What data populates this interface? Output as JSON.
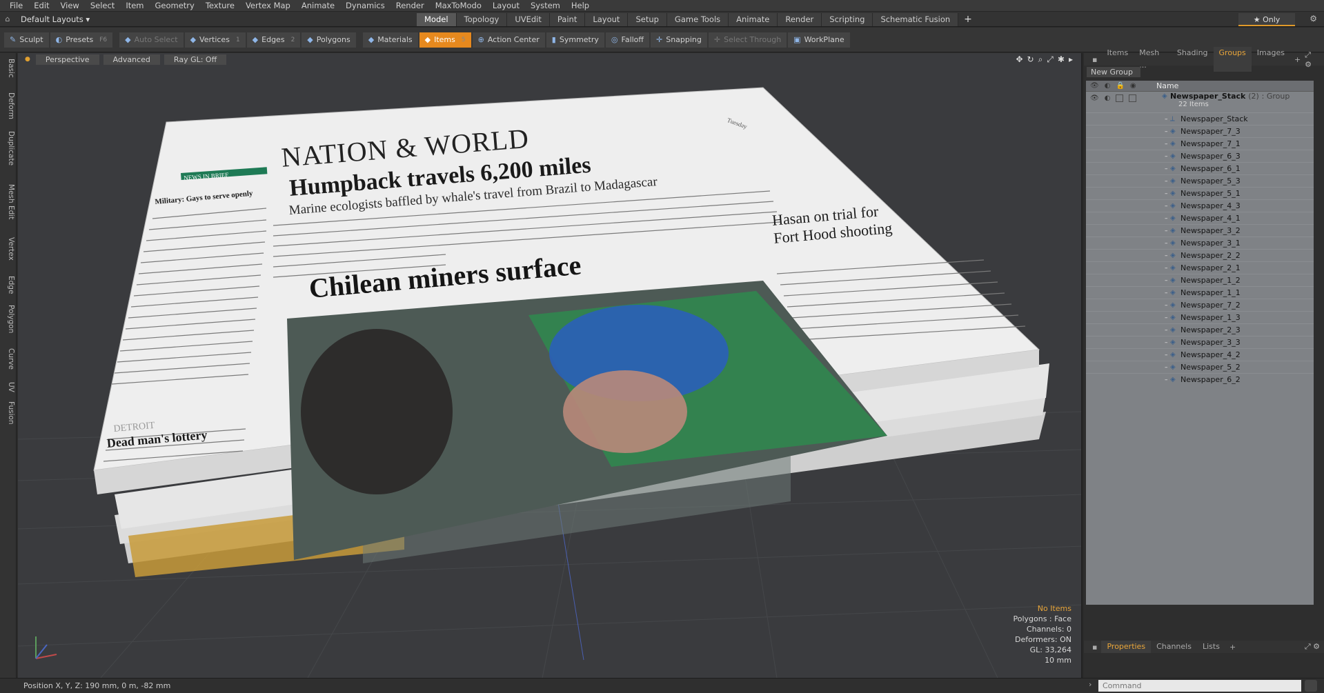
{
  "menu": [
    "File",
    "Edit",
    "View",
    "Select",
    "Item",
    "Geometry",
    "Texture",
    "Vertex Map",
    "Animate",
    "Dynamics",
    "Render",
    "MaxToModo",
    "Layout",
    "System",
    "Help"
  ],
  "layout_selector": "Default Layouts ▾",
  "tabs": [
    {
      "label": "Model",
      "active": true
    },
    {
      "label": "Topology"
    },
    {
      "label": "UVEdit"
    },
    {
      "label": "Paint"
    },
    {
      "label": "Layout"
    },
    {
      "label": "Setup"
    },
    {
      "label": "Game Tools"
    },
    {
      "label": "Animate"
    },
    {
      "label": "Render"
    },
    {
      "label": "Scripting"
    },
    {
      "label": "Schematic Fusion"
    }
  ],
  "only_label": "★ Only",
  "toolbar": {
    "sculpt": "Sculpt",
    "presets": "Presets",
    "presets_key": "F6",
    "auto_select": "Auto Select",
    "vertices": "Vertices",
    "vertices_key": "1",
    "edges": "Edges",
    "edges_key": "2",
    "polygons": "Polygons",
    "materials": "Materials",
    "items": "Items",
    "items_key": "5",
    "action_center": "Action Center",
    "symmetry": "Symmetry",
    "falloff": "Falloff",
    "snapping": "Snapping",
    "select_through": "Select Through",
    "workplane": "WorkPlane"
  },
  "left_tabs": [
    "Basic",
    "Deform",
    "Duplicate",
    "Mesh Edit",
    "Vertex",
    "Edge",
    "Polygon",
    "Curve",
    "UV",
    "Fusion"
  ],
  "viewport": {
    "perspective": "Perspective",
    "advanced": "Advanced",
    "raygl": "Ray GL: Off"
  },
  "info": {
    "items": "No Items",
    "polygons": "Polygons : Face",
    "channels": "Channels: 0",
    "deformers": "Deformers: ON",
    "gl": "GL: 33,264",
    "scale": "10 mm"
  },
  "status": {
    "position": "Position X, Y, Z:   190 mm, 0 m, -82 mm",
    "command_placeholder": "Command"
  },
  "right_tabs": [
    {
      "label": "Items"
    },
    {
      "label": "Mesh ..."
    },
    {
      "label": "Shading"
    },
    {
      "label": "Groups",
      "active": true
    },
    {
      "label": "Images"
    }
  ],
  "new_group": "New Group",
  "tree_header": {
    "name": "Name"
  },
  "group": {
    "name": "Newspaper_Stack",
    "count": "(2)",
    "type": ": Group",
    "sub": "22 Items"
  },
  "items": [
    "Newspaper_Stack",
    "Newspaper_7_3",
    "Newspaper_7_1",
    "Newspaper_6_3",
    "Newspaper_6_1",
    "Newspaper_5_3",
    "Newspaper_5_1",
    "Newspaper_4_3",
    "Newspaper_4_1",
    "Newspaper_3_2",
    "Newspaper_3_1",
    "Newspaper_2_2",
    "Newspaper_2_1",
    "Newspaper_1_2",
    "Newspaper_1_1",
    "Newspaper_7_2",
    "Newspaper_1_3",
    "Newspaper_2_3",
    "Newspaper_3_3",
    "Newspaper_4_2",
    "Newspaper_5_2",
    "Newspaper_6_2"
  ],
  "prop_tabs": [
    {
      "label": "Properties",
      "active": true
    },
    {
      "label": "Channels"
    },
    {
      "label": "Lists"
    }
  ],
  "newspaper": {
    "masthead": "NATION & WORLD",
    "headline": "Humpback travels 6,200 miles",
    "subhead": "Marine ecologists baffled by whale's travel from Brazil to Madagascar",
    "photo_headline": "Chilean miners surface",
    "side_headline": "Hasan on trial for Fort Hood shooting",
    "sidebar_title": "NEWS IN BRIEF",
    "sidebar_story": "Military: Gays to serve openly",
    "sidebar_city": "DETROIT",
    "sidebar_story2": "Dead man's lottery",
    "date": "Tuesday"
  },
  "colors": {
    "accent": "#e6891e",
    "viewport": "#3a3b3e",
    "tree": "#7f8286"
  }
}
